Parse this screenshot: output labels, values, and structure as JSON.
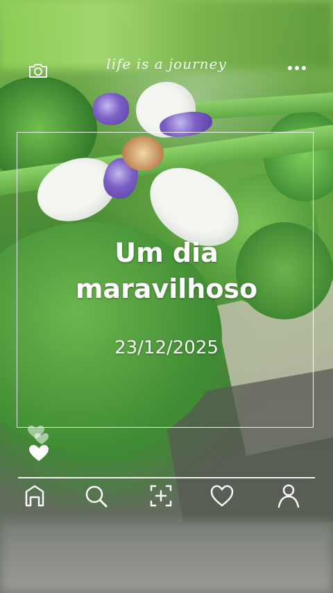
{
  "header": {
    "tagline": "life is a journey",
    "camera_icon": "camera-icon",
    "menu_icon": "more-dots-icon"
  },
  "card": {
    "title": "Um dia maravilhoso",
    "date": "23/12/2025"
  },
  "reactions": {
    "icons": [
      "heart-outline-icon",
      "heart-filled-icon"
    ]
  },
  "bottom_nav": {
    "items": [
      {
        "name": "home",
        "icon": "home-icon"
      },
      {
        "name": "search",
        "icon": "search-icon"
      },
      {
        "name": "add",
        "icon": "add-square-icon"
      },
      {
        "name": "likes",
        "icon": "heart-icon"
      },
      {
        "name": "profile",
        "icon": "profile-icon"
      }
    ]
  },
  "colors": {
    "overlay_text": "#ffffff",
    "leaf_green": "#4f9a3d",
    "petal_purple": "#6b4fc0"
  }
}
